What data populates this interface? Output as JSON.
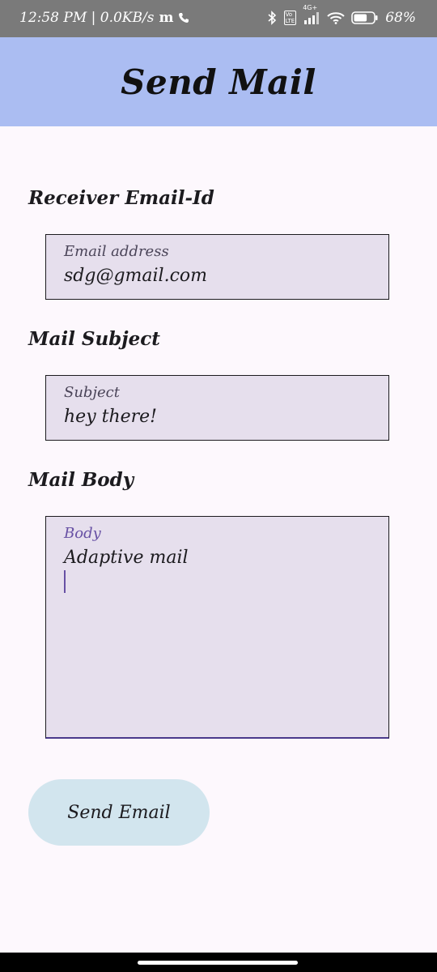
{
  "status_bar": {
    "time_speed": "12:58 PM | 0.0KB/s",
    "carrier_icon": "m",
    "call_icon": "phone-icon",
    "network_label": "4G+",
    "battery_percent": "68%",
    "battery_level": 0.68
  },
  "app_bar": {
    "title": "Send Mail"
  },
  "receiver": {
    "section_label": "Receiver Email-Id",
    "field_label": "Email address",
    "value": "sdg@gmail.com"
  },
  "subject": {
    "section_label": "Mail Subject",
    "field_label": "Subject",
    "value": "hey there!"
  },
  "body": {
    "section_label": "Mail Body",
    "field_label": "Body",
    "value": "Adaptive mail"
  },
  "actions": {
    "send_label": "Send Email"
  },
  "colors": {
    "app_bar": "#abbdf2",
    "field_bg": "#e6dfed",
    "accent": "#6750a4",
    "button_bg": "#d2e5ee",
    "page_bg": "#fdf8fd"
  }
}
